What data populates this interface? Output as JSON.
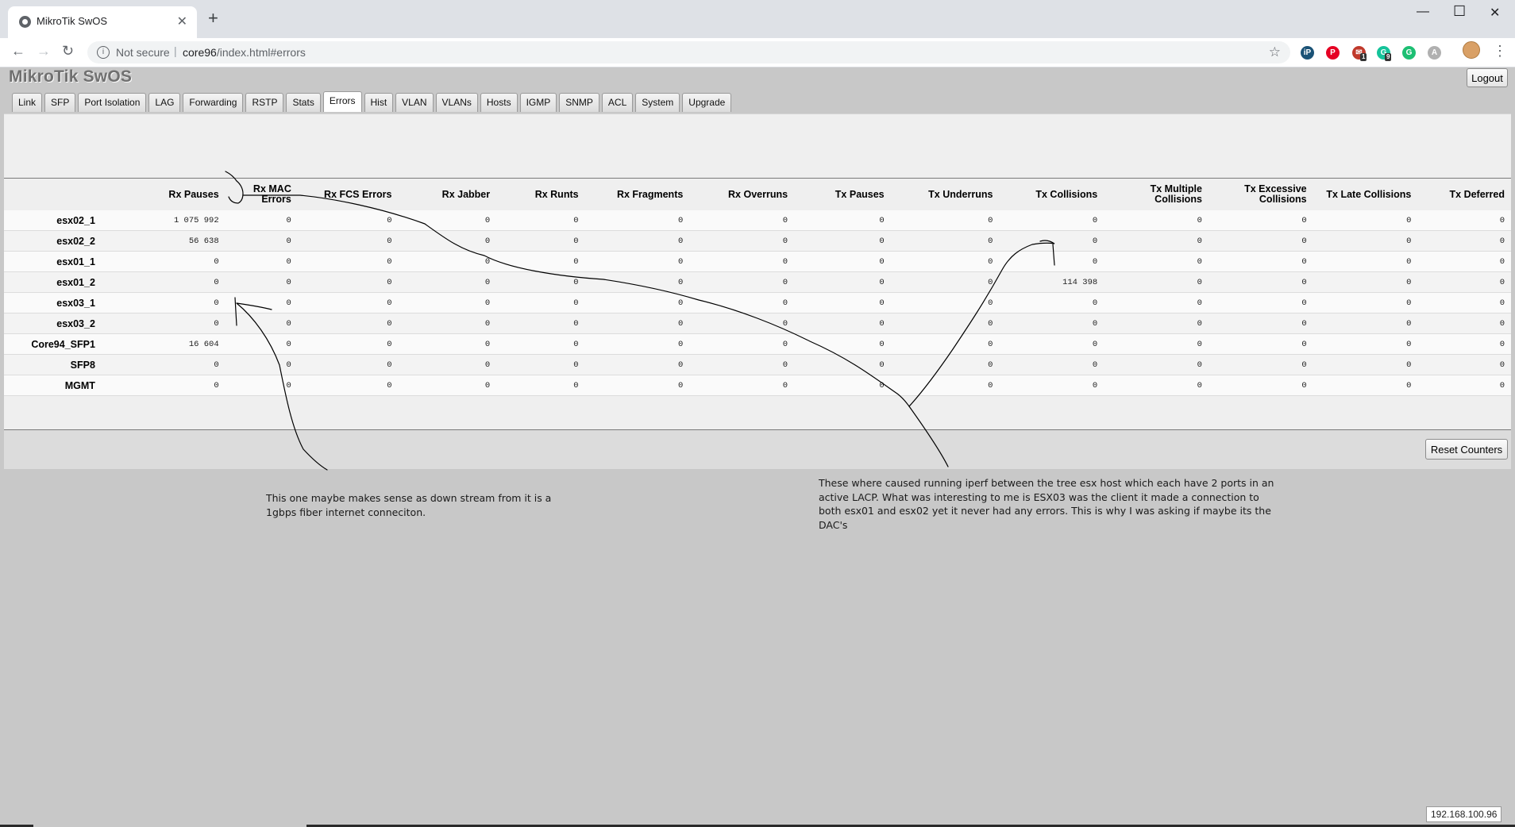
{
  "browser": {
    "tab_title": "MikroTik SwOS",
    "security_label": "Not secure",
    "url_host": "core96",
    "url_path": "/index.html#errors",
    "extensions": [
      {
        "name": "ip-extension-icon",
        "glyph": "iP",
        "color": "#1a5276"
      },
      {
        "name": "pinterest-icon",
        "glyph": "P",
        "color": "#e60023"
      },
      {
        "name": "mail-extension-icon",
        "glyph": "✉",
        "color": "#c0392b",
        "badge": "1"
      },
      {
        "name": "grammarly-icon",
        "glyph": "G",
        "color": "#15c39a",
        "badge": "9"
      },
      {
        "name": "grammarly-g-icon",
        "glyph": "G",
        "color": "#1dbf73"
      },
      {
        "name": "acrobat-icon",
        "glyph": "A",
        "color": "#b0b0b0"
      }
    ]
  },
  "app": {
    "logo": "MikroTik SwOS",
    "logout_label": "Logout",
    "tabs": [
      "Link",
      "SFP",
      "Port Isolation",
      "LAG",
      "Forwarding",
      "RSTP",
      "Stats",
      "Errors",
      "Hist",
      "VLAN",
      "VLANs",
      "Hosts",
      "IGMP",
      "SNMP",
      "ACL",
      "System",
      "Upgrade"
    ],
    "active_tab": "Errors",
    "columns": [
      "Rx Pauses",
      "Rx MAC Errors",
      "Rx FCS Errors",
      "Rx Jabber",
      "Rx Runts",
      "Rx Fragments",
      "Rx Overruns",
      "Tx Pauses",
      "Tx Underruns",
      "Tx Collisions",
      "Tx Multiple Collisions",
      "Tx Excessive Collisions",
      "Tx Late Collisions",
      "Tx Deferred"
    ],
    "rows": [
      {
        "port": "esx02_1",
        "values": [
          "1 075 992",
          "0",
          "0",
          "0",
          "0",
          "0",
          "0",
          "0",
          "0",
          "0",
          "0",
          "0",
          "0",
          "0"
        ]
      },
      {
        "port": "esx02_2",
        "values": [
          "56 638",
          "0",
          "0",
          "0",
          "0",
          "0",
          "0",
          "0",
          "0",
          "0",
          "0",
          "0",
          "0",
          "0"
        ]
      },
      {
        "port": "esx01_1",
        "values": [
          "0",
          "0",
          "0",
          "0",
          "0",
          "0",
          "0",
          "0",
          "0",
          "0",
          "0",
          "0",
          "0",
          "0"
        ]
      },
      {
        "port": "esx01_2",
        "values": [
          "0",
          "0",
          "0",
          "0",
          "0",
          "0",
          "0",
          "0",
          "0",
          "114 398",
          "0",
          "0",
          "0",
          "0"
        ]
      },
      {
        "port": "esx03_1",
        "values": [
          "0",
          "0",
          "0",
          "0",
          "0",
          "0",
          "0",
          "0",
          "0",
          "0",
          "0",
          "0",
          "0",
          "0"
        ]
      },
      {
        "port": "esx03_2",
        "values": [
          "0",
          "0",
          "0",
          "0",
          "0",
          "0",
          "0",
          "0",
          "0",
          "0",
          "0",
          "0",
          "0",
          "0"
        ]
      },
      {
        "port": "Core94_SFP1",
        "values": [
          "16 604",
          "0",
          "0",
          "0",
          "0",
          "0",
          "0",
          "0",
          "0",
          "0",
          "0",
          "0",
          "0",
          "0"
        ]
      },
      {
        "port": "SFP8",
        "values": [
          "0",
          "0",
          "0",
          "0",
          "0",
          "0",
          "0",
          "0",
          "0",
          "0",
          "0",
          "0",
          "0",
          "0"
        ]
      },
      {
        "port": "MGMT",
        "values": [
          "0",
          "0",
          "0",
          "0",
          "0",
          "0",
          "0",
          "0",
          "0",
          "0",
          "0",
          "0",
          "0",
          "0"
        ]
      }
    ],
    "reset_label": "Reset Counters",
    "ip_address": "192.168.100.96"
  },
  "annotations": {
    "left_note": "This one maybe makes sense as down stream from it is a 1gbps fiber internet conneciton.",
    "right_note": "These where caused running iperf between the tree esx host which each have  2 ports in an active LACP. What was interesting to me is ESX03 was the client it made a connection to both esx01 and esx02 yet it never had any errors. This is why I was asking if maybe its the DAC's"
  }
}
